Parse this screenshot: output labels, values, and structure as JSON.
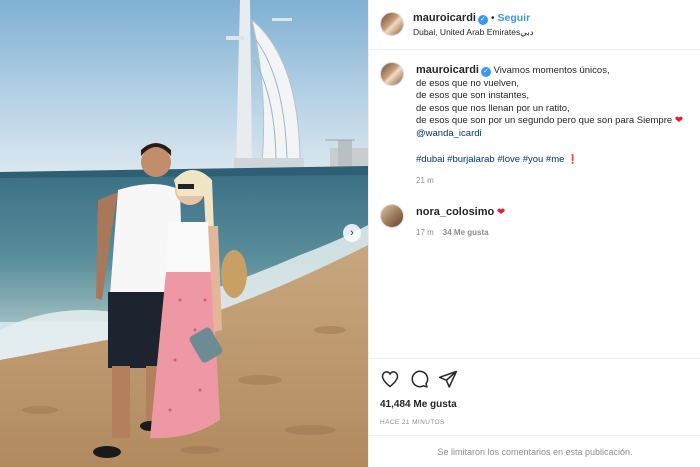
{
  "post": {
    "username": "mauroicardi",
    "follow_label": "Seguir",
    "location": "Dubai, United Arab Emiratesدبي",
    "caption_lines": [
      "Vivamos momentos únicos,",
      "de esos que no vuelven,",
      "de esos que son instantes,",
      "de esos que nos llenan por un ratito,",
      "de esos que son por un segundo pero que son para Siempre"
    ],
    "mention": "@wanda_icardi",
    "hashtags": "#dubai #burjalarab #love #you #me",
    "caption_time": "21 m",
    "comment": {
      "username": "nora_colosimo",
      "time": "17 m",
      "likes": "34 Me gusta"
    },
    "likes_count": "41,484 Me gusta",
    "posted_ago": "HACE 21 MINUTOS",
    "comments_limited": "Se limitaron los comentarios en esta publicación."
  },
  "colors": {
    "link": "#00376b",
    "accent": "#3897f0",
    "heart": "#e0202e"
  },
  "icons": [
    "heart-icon",
    "comment-icon",
    "share-icon",
    "verified-badge-icon",
    "chevron-right-icon"
  ]
}
